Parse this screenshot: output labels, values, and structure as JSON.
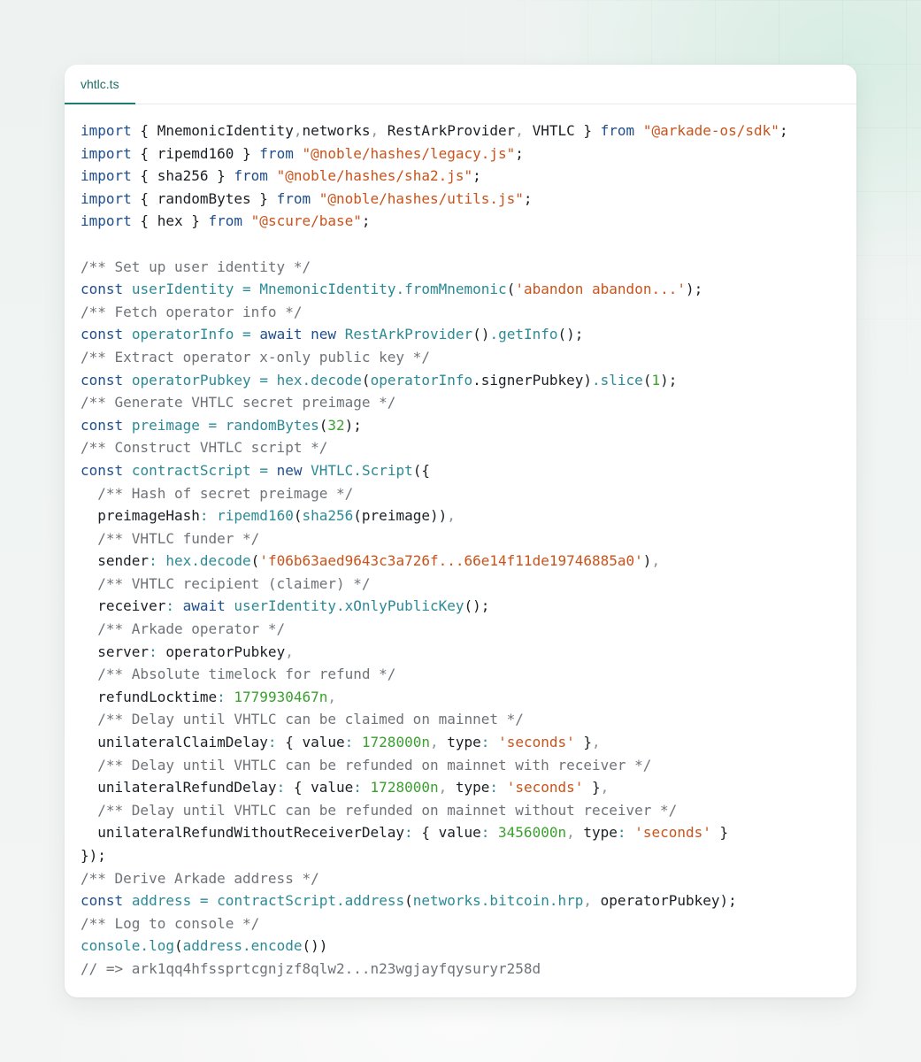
{
  "file_tab": {
    "label": "vhtlc.ts"
  },
  "colors": {
    "keyword": "#1f4e8c",
    "string": "#c9531b",
    "number": "#3aa12e",
    "comment": "#6e7378",
    "punctuation": "#8b9399",
    "identifier": "#1a1f23",
    "function": "#2b8a95",
    "tab_accent": "#1f7a70"
  },
  "code_lines": [
    [
      [
        "kw",
        "import"
      ],
      [
        "id",
        " { MnemonicIdentity"
      ],
      [
        "pn",
        ","
      ],
      [
        "id",
        "networks"
      ],
      [
        "pn",
        ","
      ],
      [
        "id",
        " RestArkProvider"
      ],
      [
        "pn",
        ","
      ],
      [
        "id",
        " VHTLC } "
      ],
      [
        "kw",
        "from"
      ],
      [
        "id",
        " "
      ],
      [
        "str",
        "\"@arkade-os/sdk\""
      ],
      [
        "id",
        ";"
      ]
    ],
    [
      [
        "kw",
        "import"
      ],
      [
        "id",
        " { ripemd160 } "
      ],
      [
        "kw",
        "from"
      ],
      [
        "id",
        " "
      ],
      [
        "str",
        "\"@noble/hashes/legacy.js\""
      ],
      [
        "id",
        ";"
      ]
    ],
    [
      [
        "kw",
        "import"
      ],
      [
        "id",
        " { sha256 } "
      ],
      [
        "kw",
        "from"
      ],
      [
        "id",
        " "
      ],
      [
        "str",
        "\"@noble/hashes/sha2.js\""
      ],
      [
        "id",
        ";"
      ]
    ],
    [
      [
        "kw",
        "import"
      ],
      [
        "id",
        " { randomBytes } "
      ],
      [
        "kw",
        "from"
      ],
      [
        "id",
        " "
      ],
      [
        "str",
        "\"@noble/hashes/utils.js\""
      ],
      [
        "id",
        ";"
      ]
    ],
    [
      [
        "kw",
        "import"
      ],
      [
        "id",
        " { hex } "
      ],
      [
        "kw",
        "from"
      ],
      [
        "id",
        " "
      ],
      [
        "str",
        "\"@scure/base\""
      ],
      [
        "id",
        ";"
      ]
    ],
    [],
    [
      [
        "cm",
        "/** Set up user identity */"
      ]
    ],
    [
      [
        "kw",
        "const"
      ],
      [
        "id",
        " "
      ],
      [
        "fn",
        "userIdentity"
      ],
      [
        "id",
        " "
      ],
      [
        "fn",
        "="
      ],
      [
        "id",
        " "
      ],
      [
        "fn",
        "MnemonicIdentity.fromMnemonic"
      ],
      [
        "id",
        "("
      ],
      [
        "str",
        "'abandon abandon...'"
      ],
      [
        "id",
        ");"
      ]
    ],
    [
      [
        "cm",
        "/** Fetch operator info */"
      ]
    ],
    [
      [
        "kw",
        "const"
      ],
      [
        "id",
        " "
      ],
      [
        "fn",
        "operatorInfo"
      ],
      [
        "id",
        " "
      ],
      [
        "fn",
        "="
      ],
      [
        "id",
        " "
      ],
      [
        "kw",
        "await"
      ],
      [
        "id",
        " "
      ],
      [
        "kw",
        "new"
      ],
      [
        "id",
        " "
      ],
      [
        "fn",
        "RestArkProvider"
      ],
      [
        "id",
        "()"
      ],
      [
        "fn",
        ".getInfo"
      ],
      [
        "id",
        "();"
      ]
    ],
    [
      [
        "cm",
        "/** Extract operator x-only public key */"
      ]
    ],
    [
      [
        "kw",
        "const"
      ],
      [
        "id",
        " "
      ],
      [
        "fn",
        "operatorPubkey"
      ],
      [
        "id",
        " "
      ],
      [
        "fn",
        "="
      ],
      [
        "id",
        " "
      ],
      [
        "fn",
        "hex.decode"
      ],
      [
        "id",
        "("
      ],
      [
        "fn",
        "operatorInfo"
      ],
      [
        "id",
        ".signerPubkey)"
      ],
      [
        "fn",
        ".slice"
      ],
      [
        "id",
        "("
      ],
      [
        "num",
        "1"
      ],
      [
        "id",
        ");"
      ]
    ],
    [
      [
        "cm",
        "/** Generate VHTLC secret preimage */"
      ]
    ],
    [
      [
        "kw",
        "const"
      ],
      [
        "id",
        " "
      ],
      [
        "fn",
        "preimage"
      ],
      [
        "id",
        " "
      ],
      [
        "fn",
        "="
      ],
      [
        "id",
        " "
      ],
      [
        "fn",
        "randomBytes"
      ],
      [
        "id",
        "("
      ],
      [
        "num",
        "32"
      ],
      [
        "id",
        ");"
      ]
    ],
    [
      [
        "cm",
        "/** Construct VHTLC script */"
      ]
    ],
    [
      [
        "kw",
        "const"
      ],
      [
        "id",
        " "
      ],
      [
        "fn",
        "contractScript"
      ],
      [
        "id",
        " "
      ],
      [
        "fn",
        "="
      ],
      [
        "id",
        " "
      ],
      [
        "kw",
        "new"
      ],
      [
        "id",
        " "
      ],
      [
        "fn",
        "VHTLC.Script"
      ],
      [
        "id",
        "({"
      ]
    ],
    [
      [
        "id",
        "  "
      ],
      [
        "cm",
        "/** Hash of secret preimage */"
      ]
    ],
    [
      [
        "id",
        "  preimageHash"
      ],
      [
        "fn",
        ":"
      ],
      [
        "id",
        " "
      ],
      [
        "fn",
        "ripemd160"
      ],
      [
        "id",
        "("
      ],
      [
        "fn",
        "sha256"
      ],
      [
        "id",
        "(preimage))"
      ],
      [
        "pn",
        ","
      ]
    ],
    [
      [
        "id",
        "  "
      ],
      [
        "cm",
        "/** VHTLC funder */"
      ]
    ],
    [
      [
        "id",
        "  sender"
      ],
      [
        "fn",
        ":"
      ],
      [
        "id",
        " "
      ],
      [
        "fn",
        "hex.decode"
      ],
      [
        "id",
        "("
      ],
      [
        "str",
        "'f06b63aed9643c3a726f...66e14f11de19746885a0'"
      ],
      [
        "id",
        ")"
      ],
      [
        "pn",
        ","
      ]
    ],
    [
      [
        "id",
        "  "
      ],
      [
        "cm",
        "/** VHTLC recipient (claimer) */"
      ]
    ],
    [
      [
        "id",
        "  receiver"
      ],
      [
        "fn",
        ":"
      ],
      [
        "id",
        " "
      ],
      [
        "kw",
        "await"
      ],
      [
        "id",
        " "
      ],
      [
        "fn",
        "userIdentity.xOnlyPublicKey"
      ],
      [
        "id",
        "();"
      ]
    ],
    [
      [
        "id",
        "  "
      ],
      [
        "cm",
        "/** Arkade operator */"
      ]
    ],
    [
      [
        "id",
        "  server"
      ],
      [
        "fn",
        ":"
      ],
      [
        "id",
        " operatorPubkey"
      ],
      [
        "pn",
        ","
      ]
    ],
    [
      [
        "id",
        "  "
      ],
      [
        "cm",
        "/** Absolute timelock for refund */"
      ]
    ],
    [
      [
        "id",
        "  refundLocktime"
      ],
      [
        "fn",
        ":"
      ],
      [
        "id",
        " "
      ],
      [
        "num",
        "1779930467n"
      ],
      [
        "pn",
        ","
      ]
    ],
    [
      [
        "id",
        "  "
      ],
      [
        "cm",
        "/** Delay until VHTLC can be claimed on mainnet */"
      ]
    ],
    [
      [
        "id",
        "  unilateralClaimDelay"
      ],
      [
        "fn",
        ":"
      ],
      [
        "id",
        " { value"
      ],
      [
        "fn",
        ":"
      ],
      [
        "id",
        " "
      ],
      [
        "num",
        "1728000n"
      ],
      [
        "pn",
        ","
      ],
      [
        "id",
        " type"
      ],
      [
        "fn",
        ":"
      ],
      [
        "id",
        " "
      ],
      [
        "str",
        "'seconds'"
      ],
      [
        "id",
        " }"
      ],
      [
        "pn",
        ","
      ]
    ],
    [
      [
        "id",
        "  "
      ],
      [
        "cm",
        "/** Delay until VHTLC can be refunded on mainnet with receiver */"
      ]
    ],
    [
      [
        "id",
        "  unilateralRefundDelay"
      ],
      [
        "fn",
        ":"
      ],
      [
        "id",
        " { value"
      ],
      [
        "fn",
        ":"
      ],
      [
        "id",
        " "
      ],
      [
        "num",
        "1728000n"
      ],
      [
        "pn",
        ","
      ],
      [
        "id",
        " type"
      ],
      [
        "fn",
        ":"
      ],
      [
        "id",
        " "
      ],
      [
        "str",
        "'seconds'"
      ],
      [
        "id",
        " }"
      ],
      [
        "pn",
        ","
      ]
    ],
    [
      [
        "id",
        "  "
      ],
      [
        "cm",
        "/** Delay until VHTLC can be refunded on mainnet without receiver */"
      ]
    ],
    [
      [
        "id",
        "  unilateralRefundWithoutReceiverDelay"
      ],
      [
        "fn",
        ":"
      ],
      [
        "id",
        " { value"
      ],
      [
        "fn",
        ":"
      ],
      [
        "id",
        " "
      ],
      [
        "num",
        "3456000n"
      ],
      [
        "pn",
        ","
      ],
      [
        "id",
        " type"
      ],
      [
        "fn",
        ":"
      ],
      [
        "id",
        " "
      ],
      [
        "str",
        "'seconds'"
      ],
      [
        "id",
        " }"
      ]
    ],
    [
      [
        "id",
        "});"
      ]
    ],
    [
      [
        "cm",
        "/** Derive Arkade address */"
      ]
    ],
    [
      [
        "kw",
        "const"
      ],
      [
        "id",
        " "
      ],
      [
        "fn",
        "address"
      ],
      [
        "id",
        " "
      ],
      [
        "fn",
        "="
      ],
      [
        "id",
        " "
      ],
      [
        "fn",
        "contractScript.address"
      ],
      [
        "id",
        "("
      ],
      [
        "fn",
        "networks.bitcoin.hrp"
      ],
      [
        "pn",
        ","
      ],
      [
        "id",
        " operatorPubkey);"
      ]
    ],
    [
      [
        "cm",
        "/** Log to console */"
      ]
    ],
    [
      [
        "fn",
        "console.log"
      ],
      [
        "id",
        "("
      ],
      [
        "fn",
        "address.encode"
      ],
      [
        "id",
        "())"
      ]
    ],
    [
      [
        "cm",
        "// => ark1qq4hfssprtcgnjzf8qlw2...n23wgjayfqysuryr258d"
      ]
    ]
  ]
}
